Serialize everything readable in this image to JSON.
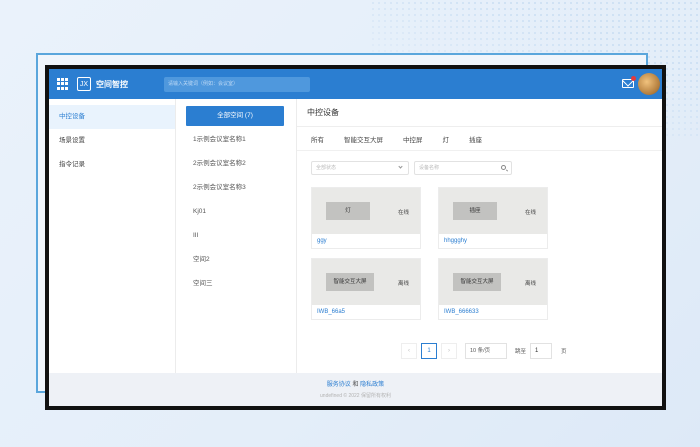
{
  "header": {
    "logo_text": "JX",
    "app_title": "空间智控",
    "search_placeholder": "请输入关键词（例如：会议室）"
  },
  "sidebar": {
    "items": [
      {
        "label": "中控设备",
        "active": true
      },
      {
        "label": "场景设置",
        "active": false
      },
      {
        "label": "指令记录",
        "active": false
      }
    ]
  },
  "rooms": {
    "all_button": "全部空间 (7)",
    "items": [
      "1示例会议室名称1",
      "2示例会议室名称2",
      "2示例会议室名称3",
      "Kj01",
      "III",
      "空间2",
      "空间三"
    ]
  },
  "content": {
    "title": "中控设备",
    "tabs": [
      "所有",
      "智能交互大屏",
      "中控屏",
      "灯",
      "插座"
    ],
    "status_placeholder": "全部状态",
    "name_placeholder": "设备名称",
    "cards": [
      {
        "type_label": "灯",
        "status": "在线",
        "name": "ggy"
      },
      {
        "type_label": "插座",
        "status": "在线",
        "name": "hhggghy"
      },
      {
        "type_label": "智能交互大屏",
        "status": "离线",
        "name": "IWB_66a5"
      },
      {
        "type_label": "智能交互大屏",
        "status": "离线",
        "name": "IWB_666633"
      }
    ]
  },
  "pagination": {
    "prev": "‹",
    "current_page": "1",
    "next": "›",
    "page_size": "10 条/页",
    "goto_label": "跳至",
    "goto_value": "1",
    "page_suffix": "页"
  },
  "footer": {
    "service_link": "服务协议",
    "and_text": "和",
    "privacy_link": "隐私政策",
    "copyright": "undefined © 2022 保留所有权利"
  },
  "colors": {
    "primary": "#2b7ed1",
    "frame": "#5aa6dc"
  }
}
